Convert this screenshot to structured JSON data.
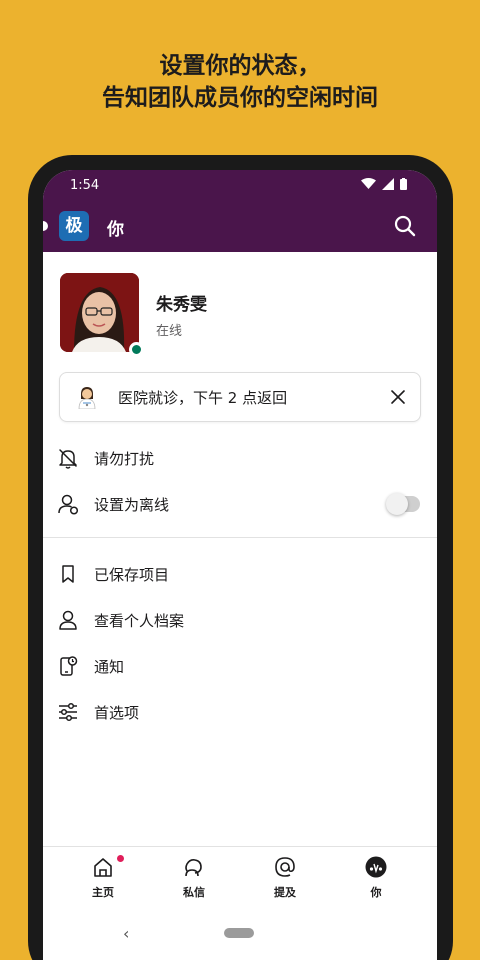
{
  "headline": {
    "line1": "设置你的状态，",
    "line2": "告知团队成员你的空闲时间"
  },
  "status_bar": {
    "time": "1:54"
  },
  "app_bar": {
    "workspace_initial": "极",
    "title": "你",
    "accent": "#4A154B"
  },
  "profile": {
    "name": "朱秀雯",
    "presence": "在线"
  },
  "custom_status": {
    "emoji": "health-worker-icon",
    "text": "医院就诊，下午 2 点返回"
  },
  "menu": {
    "dnd": "请勿打扰",
    "set_away": "设置为离线",
    "away_enabled": false,
    "saved": "已保存项目",
    "view_profile": "查看个人档案",
    "notifications": "通知",
    "preferences": "首选项"
  },
  "tabs": [
    {
      "label": "主页",
      "icon": "home-icon",
      "has_unread": true
    },
    {
      "label": "私信",
      "icon": "dm-icon"
    },
    {
      "label": "提及",
      "icon": "mention-icon"
    },
    {
      "label": "你",
      "icon": "you-avatar-icon",
      "active": true
    }
  ],
  "colors": {
    "background": "#ECB22E",
    "presence_online": "#007a5a",
    "unread_badge": "#e01e5a"
  }
}
